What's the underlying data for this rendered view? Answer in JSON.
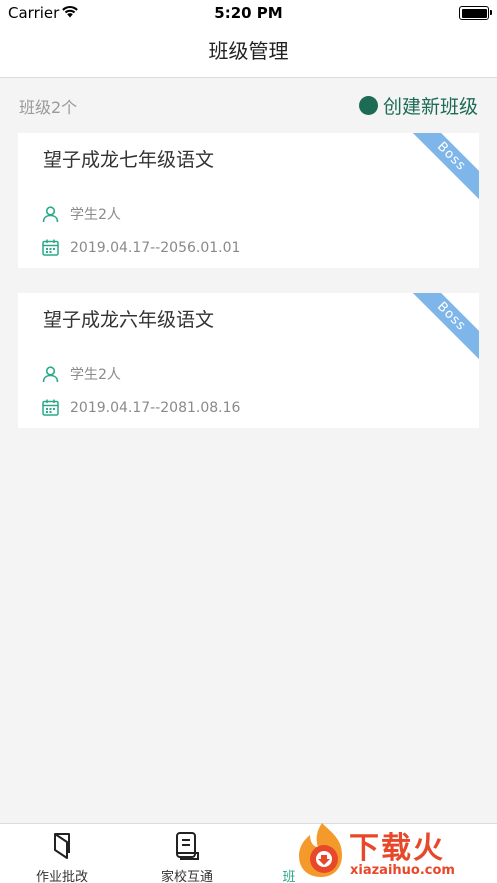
{
  "status_bar": {
    "carrier": "Carrier",
    "time": "5:20 PM"
  },
  "header": {
    "title": "班级管理"
  },
  "summary": {
    "class_count": "班级2个",
    "create_label": "创建新班级"
  },
  "classes": [
    {
      "name": "望子成龙七年级语文",
      "students": "学生2人",
      "period": "2019.04.17--2056.01.01",
      "badge": "Boss"
    },
    {
      "name": "望子成龙六年级语文",
      "students": "学生2人",
      "period": "2019.04.17--2081.08.16",
      "badge": "Boss"
    }
  ],
  "tabs": [
    {
      "label": "作业批改",
      "icon": "book-icon"
    },
    {
      "label": "家校互通",
      "icon": "document-icon"
    },
    {
      "label": "班",
      "icon": "class-icon",
      "active": true
    }
  ],
  "watermark": {
    "text": "下载火",
    "url": "xiazaihuo.com"
  },
  "colors": {
    "accent": "#1d6b55",
    "tab_active": "#2aa889",
    "ribbon": "#7fb6ea",
    "background": "#f4f4f4"
  }
}
